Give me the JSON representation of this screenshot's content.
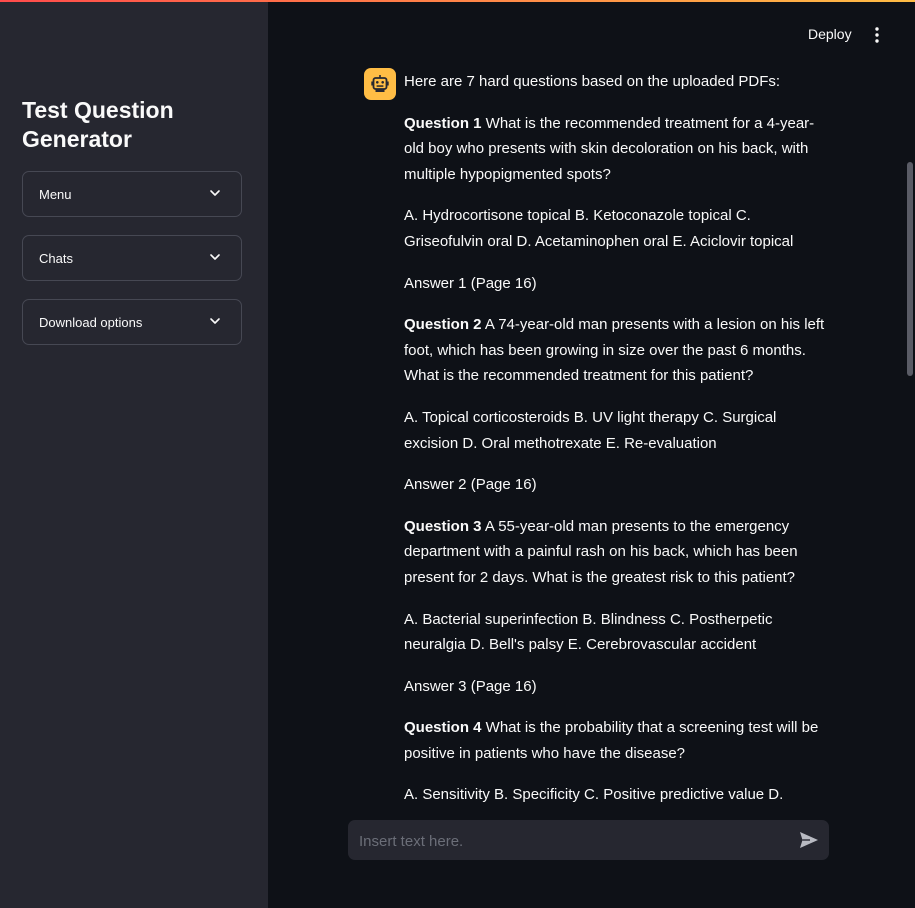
{
  "app": {
    "accent_start": "#ff4b4b",
    "accent_end": "#ffbd45"
  },
  "sidebar": {
    "title": "Test Question Generator",
    "expanders": [
      {
        "label": "Menu",
        "icon": "chevron-down-icon"
      },
      {
        "label": "Chats",
        "icon": "chevron-down-icon"
      },
      {
        "label": "Download options",
        "icon": "chevron-down-icon"
      }
    ]
  },
  "header": {
    "deploy_label": "Deploy",
    "menu_icon": "vertical-dots-icon"
  },
  "chat": {
    "avatar_icon": "robot-icon",
    "avatar_color": "#ffbd45",
    "intro": "Here are 7 hard questions based on the uploaded PDFs:",
    "questions": [
      {
        "label": "Question 1",
        "text": " What is the recommended treatment for a 4-year-old boy who presents with skin decoloration on his back, with multiple hypopigmented spots?",
        "options": "A. Hydrocortisone topical B. Ketoconazole topical C. Griseofulvin oral D. Acetaminophen oral E. Aciclovir topical",
        "answer": "Answer 1 (Page 16)"
      },
      {
        "label": "Question 2",
        "text": " A 74-year-old man presents with a lesion on his left foot, which has been growing in size over the past 6 months. What is the recommended treatment for this patient?",
        "options": "A. Topical corticosteroids B. UV light therapy C. Surgical excision D. Oral methotrexate E. Re-evaluation",
        "answer": "Answer 2 (Page 16)"
      },
      {
        "label": "Question 3",
        "text": " A 55-year-old man presents to the emergency department with a painful rash on his back, which has been present for 2 days. What is the greatest risk to this patient?",
        "options": "A. Bacterial superinfection B. Blindness C. Postherpetic neuralgia D. Bell's palsy E. Cerebrovascular accident",
        "answer": "Answer 3 (Page 16)"
      },
      {
        "label": "Question 4",
        "text": " What is the probability that a screening test will be positive in patients who have the disease?",
        "options": "A. Sensitivity B. Specificity C. Positive predictive value D.",
        "answer": ""
      }
    ]
  },
  "input": {
    "placeholder": "Insert text here.",
    "value": "",
    "send_icon": "send-icon"
  }
}
